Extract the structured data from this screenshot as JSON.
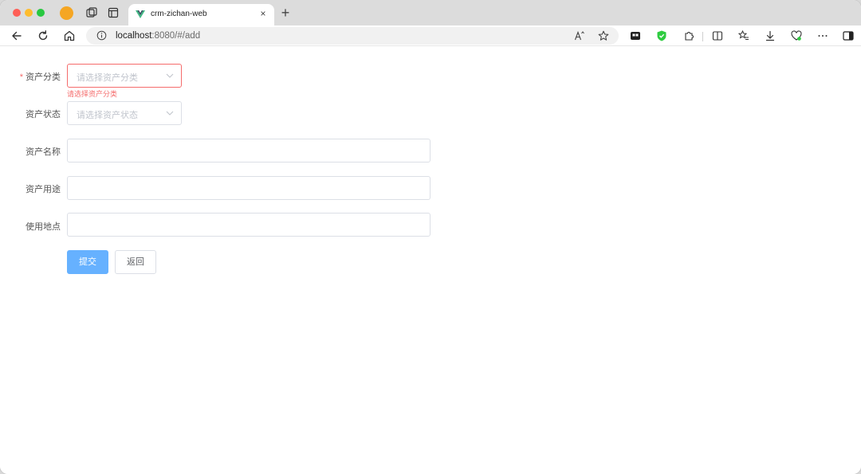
{
  "browser": {
    "tab_title": "crm-zichan-web",
    "url_host": "localhost",
    "url_rest": ":8080/#/add",
    "new_tab": "+",
    "close": "×"
  },
  "form": {
    "category": {
      "label": "资产分类",
      "required": "*",
      "placeholder": "请选择资产分类",
      "error": "请选择资产分类"
    },
    "status": {
      "label": "资产状态",
      "placeholder": "请选择资产状态"
    },
    "name": {
      "label": "资产名称",
      "value": ""
    },
    "usage": {
      "label": "资产用途",
      "value": ""
    },
    "location": {
      "label": "使用地点",
      "value": ""
    },
    "submit_label": "提交",
    "back_label": "返回"
  },
  "colors": {
    "primary": "#66b1ff",
    "error": "#f56c6c",
    "border": "#dcdfe6",
    "placeholder": "#c0c4cc"
  }
}
